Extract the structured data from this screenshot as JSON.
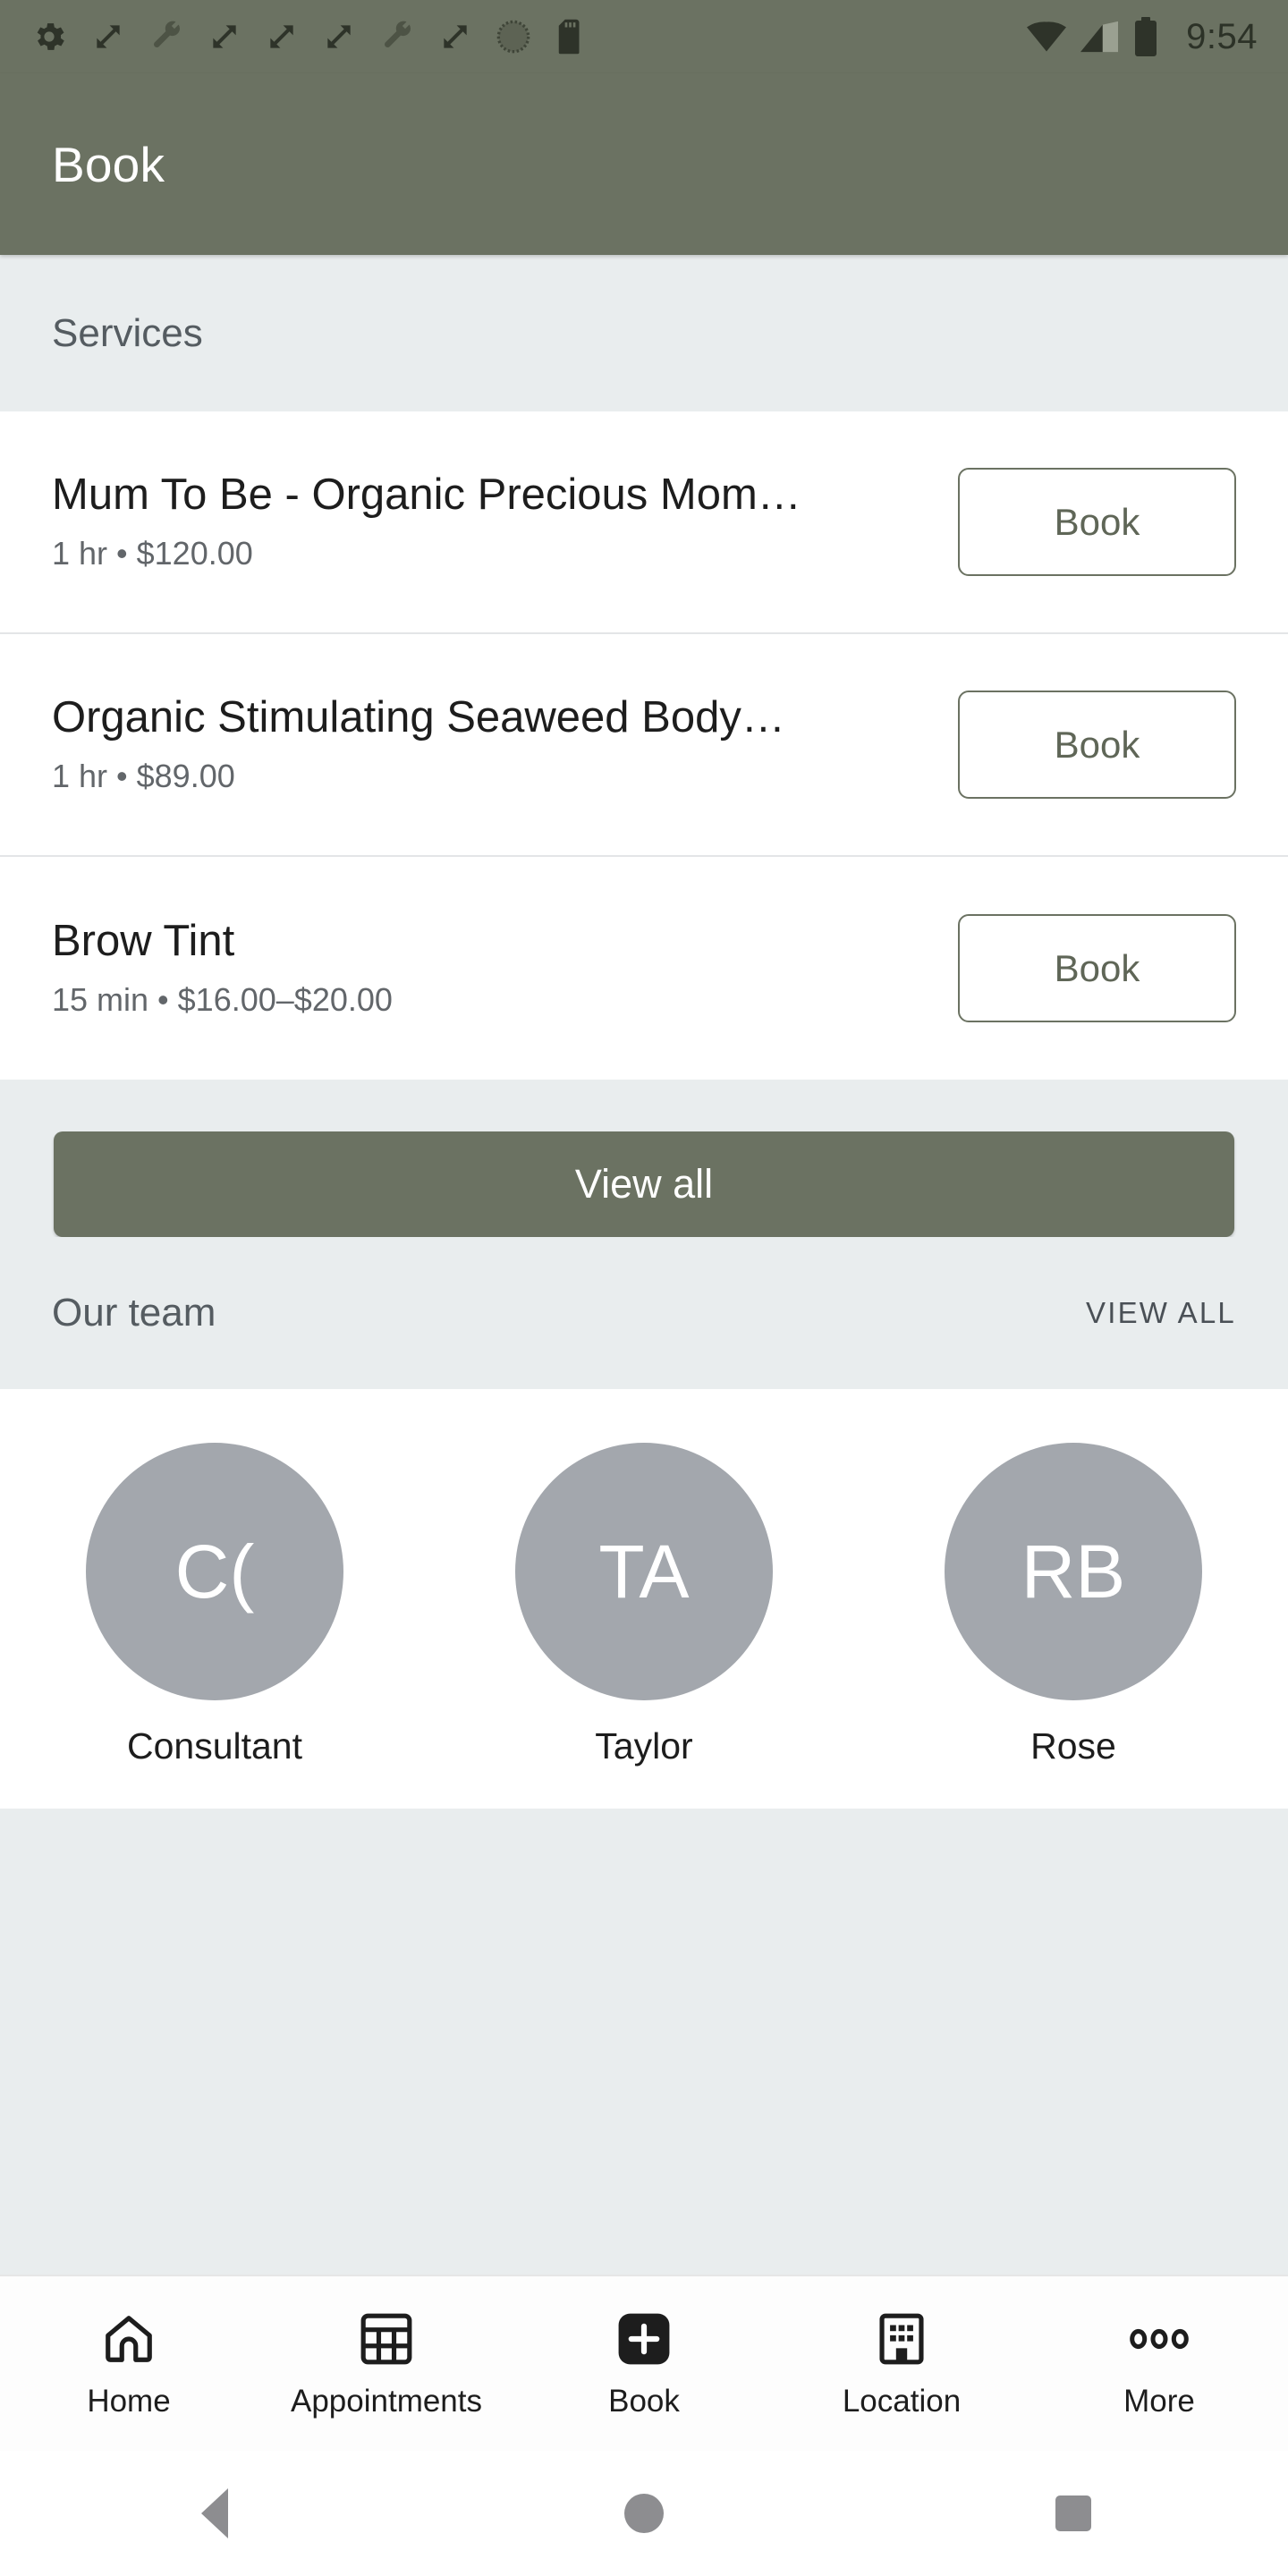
{
  "status_bar": {
    "icons": [
      "gear-icon",
      "sync-arrows-icon",
      "wrench-icon",
      "sync-arrows-icon",
      "sync-arrows-icon",
      "sync-arrows-icon",
      "wrench-icon",
      "sync-arrows-icon",
      "dotted-circle-icon",
      "sd-card-icon"
    ],
    "wifi": "wifi-icon",
    "signal": "cell-signal-icon",
    "battery": "battery-icon",
    "clock": "9:54"
  },
  "app_bar": {
    "title": "Book"
  },
  "services": {
    "section_title": "Services",
    "items": [
      {
        "name": "Mum To Be - Organic Precious Mom…",
        "meta": "1 hr • $120.00",
        "button": "Book"
      },
      {
        "name": "Organic Stimulating Seaweed Body…",
        "meta": "1 hr • $89.00",
        "button": "Book"
      },
      {
        "name": "Brow Tint",
        "meta": "15 min • $16.00–$20.00",
        "button": "Book"
      }
    ],
    "view_all_button": "View all"
  },
  "team": {
    "section_title": "Our team",
    "view_all_link": "VIEW ALL",
    "members": [
      {
        "initials": "C(",
        "name": "Consultant"
      },
      {
        "initials": "TA",
        "name": "Taylor"
      },
      {
        "initials": "RB",
        "name": "Rose"
      }
    ]
  },
  "bottom_nav": {
    "items": [
      {
        "label": "Home",
        "icon": "home-icon"
      },
      {
        "label": "Appointments",
        "icon": "calendar-grid-icon"
      },
      {
        "label": "Book",
        "icon": "plus-square-icon"
      },
      {
        "label": "Location",
        "icon": "building-icon"
      },
      {
        "label": "More",
        "icon": "more-dots-icon"
      }
    ]
  },
  "system_nav": {
    "back": "back-triangle-icon",
    "home": "home-circle-icon",
    "recents": "recents-square-icon"
  },
  "colors": {
    "brand_green": "#6b7262",
    "surface_gray": "#e9edee",
    "avatar_gray": "#a3a7ad"
  }
}
